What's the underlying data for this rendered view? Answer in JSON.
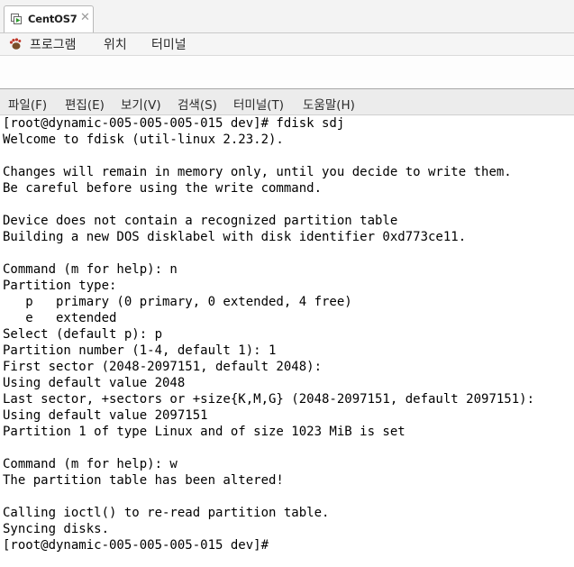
{
  "vm_tab": {
    "label": "CentOS7",
    "close_glyph": "✕",
    "icon": "vm-icon"
  },
  "gnome_panel": {
    "apps_icon": "gnome-foot-icon",
    "items": [
      "프로그램",
      "위치",
      "터미널"
    ]
  },
  "terminal_menu": {
    "items": [
      "파일(F)",
      "편집(E)",
      "보기(V)",
      "검색(S)",
      "터미널(T)",
      "도움말(H)"
    ]
  },
  "terminal": {
    "lines": [
      "[root@dynamic-005-005-005-015 dev]# fdisk sdj",
      "Welcome to fdisk (util-linux 2.23.2).",
      "",
      "Changes will remain in memory only, until you decide to write them.",
      "Be careful before using the write command.",
      "",
      "Device does not contain a recognized partition table",
      "Building a new DOS disklabel with disk identifier 0xd773ce11.",
      "",
      "Command (m for help): n",
      "Partition type:",
      "   p   primary (0 primary, 0 extended, 4 free)",
      "   e   extended",
      "Select (default p): p",
      "Partition number (1-4, default 1): 1",
      "First sector (2048-2097151, default 2048):",
      "Using default value 2048",
      "Last sector, +sectors or +size{K,M,G} (2048-2097151, default 2097151):",
      "Using default value 2097151",
      "Partition 1 of type Linux and of size 1023 MiB is set",
      "",
      "Command (m for help): w",
      "The partition table has been altered!",
      "",
      "Calling ioctl() to re-read partition table.",
      "Syncing disks.",
      "[root@dynamic-005-005-005-015 dev]#"
    ]
  }
}
